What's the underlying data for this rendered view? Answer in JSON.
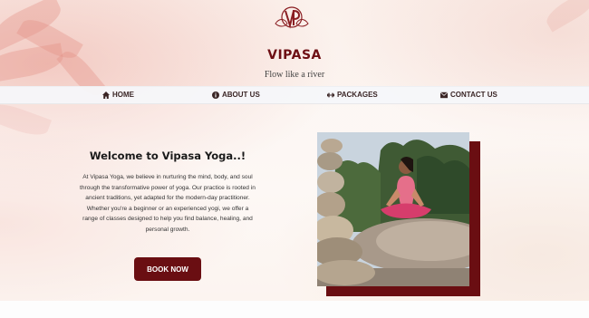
{
  "brand": {
    "name": "VIPASA",
    "tagline": "Flow like a river",
    "logo_icon": "vp-lotus-logo"
  },
  "nav": {
    "items": [
      {
        "label": "HOME",
        "icon": "home-icon"
      },
      {
        "label": "ABOUT US",
        "icon": "info-icon"
      },
      {
        "label": "PACKAGES",
        "icon": "dumbbell-icon"
      },
      {
        "label": "CONTACT US",
        "icon": "envelope-icon"
      }
    ]
  },
  "hero": {
    "title": "Welcome to Vipasa Yoga..!",
    "description": "At Vipasa Yoga, we believe in nurturing the mind, body, and soul through the transformative power of yoga. Our practice is rooted in ancient traditions, yet adapted for the modern-day practitioner. Whether you're a beginner or an experienced yogi, we offer a range of classes designed to help you find balance, healing, and personal growth.",
    "button_label": "BOOK NOW"
  },
  "colors": {
    "accent": "#6a0e12",
    "nav_bg": "#f5f7fa",
    "text": "#333333"
  }
}
